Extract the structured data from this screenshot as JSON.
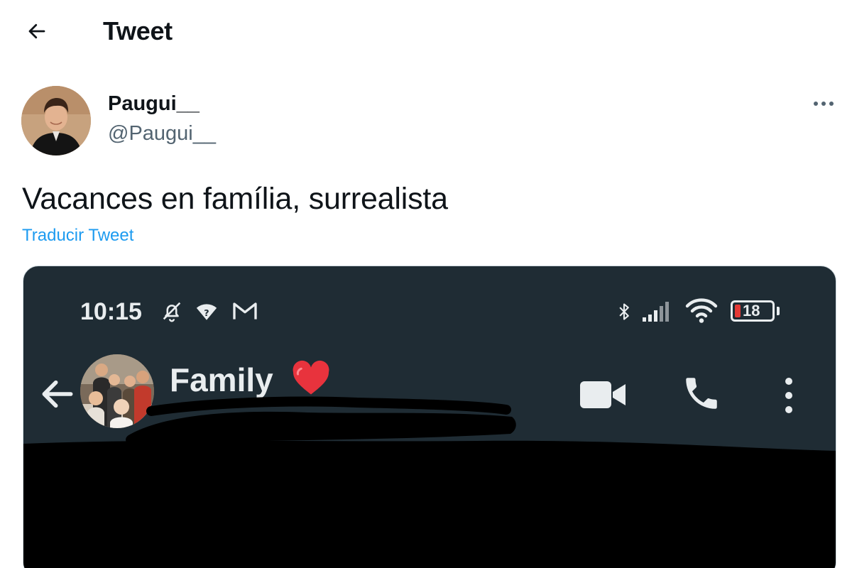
{
  "header": {
    "title": "Tweet",
    "back_icon": "arrow-left-icon"
  },
  "author": {
    "display_name": "Paugui__",
    "handle": "@Paugui__",
    "more_icon": "more-horizontal-icon"
  },
  "tweet": {
    "text": "Vacances en família, surrealista",
    "translate_label": "Traducir Tweet"
  },
  "media": {
    "status_bar": {
      "time": "10:15",
      "left_icons": [
        "bell-off-icon",
        "wifi-question-icon",
        "gmail-icon"
      ],
      "right_icons": [
        "bluetooth-icon",
        "signal-icon",
        "wifi-icon"
      ],
      "battery_level": "18"
    },
    "chat": {
      "name": "Family",
      "emoji": "heart-icon",
      "actions": [
        "back-arrow-icon",
        "video-call-icon",
        "phone-icon",
        "more-vertical-icon"
      ]
    }
  },
  "colors": {
    "link": "#1d9bf0",
    "secondary_text": "#536471",
    "chat_header_bg": "#1f2c34",
    "battery_low": "#e53935",
    "heart": "#e8333d"
  }
}
